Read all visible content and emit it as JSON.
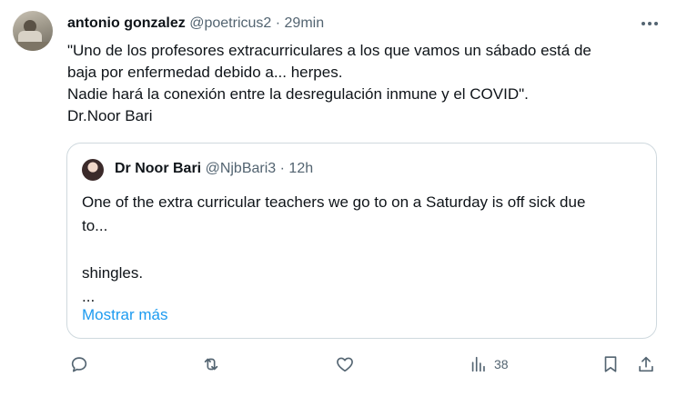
{
  "author": {
    "name": "antonio gonzalez",
    "handle": "@poetricus2",
    "separator": "·",
    "time": "29min"
  },
  "body": {
    "lines": [
      "\"Uno de los profesores extracurriculares a los que vamos un sábado está de",
      "baja por enfermedad debido a... herpes.",
      "Nadie hará la conexión entre la desregulación inmune y el COVID\".",
      "Dr.Noor Bari"
    ]
  },
  "quote": {
    "name": "Dr Noor Bari",
    "handle": "@NjbBari3",
    "separator": "·",
    "time": "12h",
    "lines": [
      "One of the extra curricular teachers we go to on a Saturday is off sick due",
      "to...",
      "",
      "shingles.",
      "..."
    ],
    "show_more": "Mostrar más"
  },
  "actions": {
    "reply_icon": "reply-icon",
    "retweet_icon": "retweet-icon",
    "like_icon": "heart-icon",
    "views_icon": "views-icon",
    "views_count": "38",
    "bookmark_icon": "bookmark-icon",
    "share_icon": "share-icon"
  },
  "colors": {
    "accent": "#1d9bf0",
    "muted": "#536471",
    "border": "#cfd9de"
  }
}
